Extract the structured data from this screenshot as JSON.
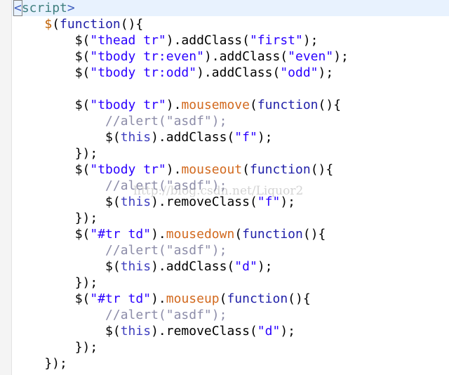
{
  "code_lines": [
    [
      {
        "t": "<",
        "c": "tag",
        "b": 1
      },
      {
        "t": "script",
        "c": "tagname"
      },
      {
        "t": ">",
        "c": "tag"
      }
    ],
    [
      {
        "t": "    "
      },
      {
        "t": "$",
        "c": "jq"
      },
      {
        "t": "(",
        "c": "plain"
      },
      {
        "t": "function",
        "c": "funcname"
      },
      {
        "t": "(){",
        "c": "plain"
      }
    ],
    [
      {
        "t": "        $(",
        "c": "plain"
      },
      {
        "t": "\"thead tr\"",
        "c": "str"
      },
      {
        "t": ").addClass(",
        "c": "plain"
      },
      {
        "t": "\"first\"",
        "c": "str"
      },
      {
        "t": ");",
        "c": "plain"
      }
    ],
    [
      {
        "t": "        $(",
        "c": "plain"
      },
      {
        "t": "\"tbody tr:even\"",
        "c": "str"
      },
      {
        "t": ").addClass(",
        "c": "plain"
      },
      {
        "t": "\"even\"",
        "c": "str"
      },
      {
        "t": ");",
        "c": "plain"
      }
    ],
    [
      {
        "t": "        $(",
        "c": "plain"
      },
      {
        "t": "\"tbody tr:odd\"",
        "c": "str"
      },
      {
        "t": ").addClass(",
        "c": "plain"
      },
      {
        "t": "\"odd\"",
        "c": "str"
      },
      {
        "t": ");",
        "c": "plain"
      }
    ],
    [
      {
        "t": ""
      }
    ],
    [
      {
        "t": "        $(",
        "c": "plain"
      },
      {
        "t": "\"tbody tr\"",
        "c": "str"
      },
      {
        "t": ").",
        "c": "plain"
      },
      {
        "t": "mousemove",
        "c": "event"
      },
      {
        "t": "(",
        "c": "plain"
      },
      {
        "t": "function",
        "c": "funcname"
      },
      {
        "t": "(){",
        "c": "plain"
      }
    ],
    [
      {
        "t": "            "
      },
      {
        "t": "//alert(\"asdf\");",
        "c": "comment"
      }
    ],
    [
      {
        "t": "            $(",
        "c": "plain"
      },
      {
        "t": "this",
        "c": "this"
      },
      {
        "t": ").addClass(",
        "c": "plain"
      },
      {
        "t": "\"f\"",
        "c": "str"
      },
      {
        "t": ");",
        "c": "plain"
      }
    ],
    [
      {
        "t": "        });",
        "c": "plain"
      }
    ],
    [
      {
        "t": "        $(",
        "c": "plain"
      },
      {
        "t": "\"tbody tr\"",
        "c": "str"
      },
      {
        "t": ").",
        "c": "plain"
      },
      {
        "t": "mouseout",
        "c": "event"
      },
      {
        "t": "(",
        "c": "plain"
      },
      {
        "t": "function",
        "c": "funcname"
      },
      {
        "t": "(){",
        "c": "plain"
      }
    ],
    [
      {
        "t": "            "
      },
      {
        "t": "//alert(\"asdf\");",
        "c": "comment"
      }
    ],
    [
      {
        "t": "            $(",
        "c": "plain"
      },
      {
        "t": "this",
        "c": "this"
      },
      {
        "t": ").removeClass(",
        "c": "plain"
      },
      {
        "t": "\"f\"",
        "c": "str"
      },
      {
        "t": ");",
        "c": "plain"
      }
    ],
    [
      {
        "t": "        });",
        "c": "plain"
      }
    ],
    [
      {
        "t": "        $(",
        "c": "plain"
      },
      {
        "t": "\"#tr td\"",
        "c": "str"
      },
      {
        "t": ").",
        "c": "plain"
      },
      {
        "t": "mousedown",
        "c": "event"
      },
      {
        "t": "(",
        "c": "plain"
      },
      {
        "t": "function",
        "c": "funcname"
      },
      {
        "t": "(){",
        "c": "plain"
      }
    ],
    [
      {
        "t": "            "
      },
      {
        "t": "//alert(\"asdf\");",
        "c": "comment"
      }
    ],
    [
      {
        "t": "            $(",
        "c": "plain"
      },
      {
        "t": "this",
        "c": "this"
      },
      {
        "t": ").addClass(",
        "c": "plain"
      },
      {
        "t": "\"d\"",
        "c": "str"
      },
      {
        "t": ");",
        "c": "plain"
      }
    ],
    [
      {
        "t": "        });",
        "c": "plain"
      }
    ],
    [
      {
        "t": "        $(",
        "c": "plain"
      },
      {
        "t": "\"#tr td\"",
        "c": "str"
      },
      {
        "t": ").",
        "c": "plain"
      },
      {
        "t": "mouseup",
        "c": "event"
      },
      {
        "t": "(",
        "c": "plain"
      },
      {
        "t": "function",
        "c": "funcname"
      },
      {
        "t": "(){",
        "c": "plain"
      }
    ],
    [
      {
        "t": "            "
      },
      {
        "t": "//alert(\"asdf\");",
        "c": "comment"
      }
    ],
    [
      {
        "t": "            $(",
        "c": "plain"
      },
      {
        "t": "this",
        "c": "this"
      },
      {
        "t": ").removeClass(",
        "c": "plain"
      },
      {
        "t": "\"d\"",
        "c": "str"
      },
      {
        "t": ");",
        "c": "plain"
      }
    ],
    [
      {
        "t": "        });",
        "c": "plain"
      }
    ],
    [
      {
        "t": "    });",
        "c": "plain"
      }
    ]
  ],
  "watermark": "http://blog.csdn.net/Liquor2",
  "colors": {
    "background": "#ffffff",
    "current_line": "#e8f2fe",
    "string": "#2a00ff",
    "comment": "#8c8ca8",
    "jquery_dollar": "#bf5f00",
    "event_method": "#d2691e",
    "keyword_function": "#1f1fa8",
    "this_keyword": "#3f3fbf",
    "tag": "#3f5fbf",
    "tag_name": "#3f7f7f"
  }
}
